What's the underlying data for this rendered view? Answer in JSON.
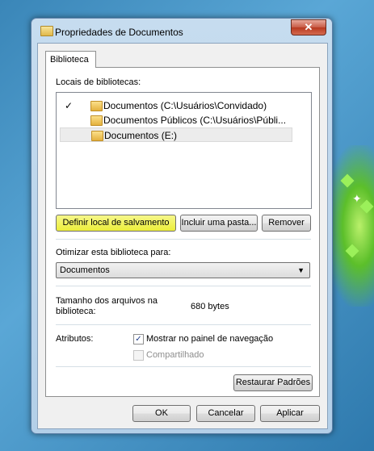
{
  "window": {
    "title": "Propriedades de Documentos",
    "close_symbol": "✕"
  },
  "tabs": [
    {
      "label": "Biblioteca"
    }
  ],
  "library": {
    "locations_label": "Locais de bibliotecas:",
    "locations": [
      {
        "checked": true,
        "check_symbol": "✓",
        "label": "Documentos (C:\\Usuários\\Convidado)"
      },
      {
        "checked": false,
        "label": "Documentos Públicos (C:\\Usuários\\Públi..."
      },
      {
        "checked": false,
        "label": "Documentos (E:)",
        "selected": true
      }
    ],
    "buttons": {
      "set_save_location": "Definir local de salvamento",
      "include_folder": "Incluir uma pasta...",
      "remove": "Remover"
    },
    "optimize_label": "Otimizar esta biblioteca para:",
    "optimize_value": "Documentos",
    "size_label": "Tamanho dos arquivos na biblioteca:",
    "size_value": "680 bytes",
    "attributes_label": "Atributos:",
    "show_in_nav": {
      "label": "Mostrar no painel de navegação",
      "checked": true,
      "symbol": "✓"
    },
    "shared": {
      "label": "Compartilhado",
      "checked": false,
      "disabled": true
    },
    "restore_defaults": "Restaurar Padrões"
  },
  "dialog_buttons": {
    "ok": "OK",
    "cancel": "Cancelar",
    "apply": "Aplicar"
  },
  "colors": {
    "highlight": "#ecee3a",
    "selection": "#ececec"
  }
}
